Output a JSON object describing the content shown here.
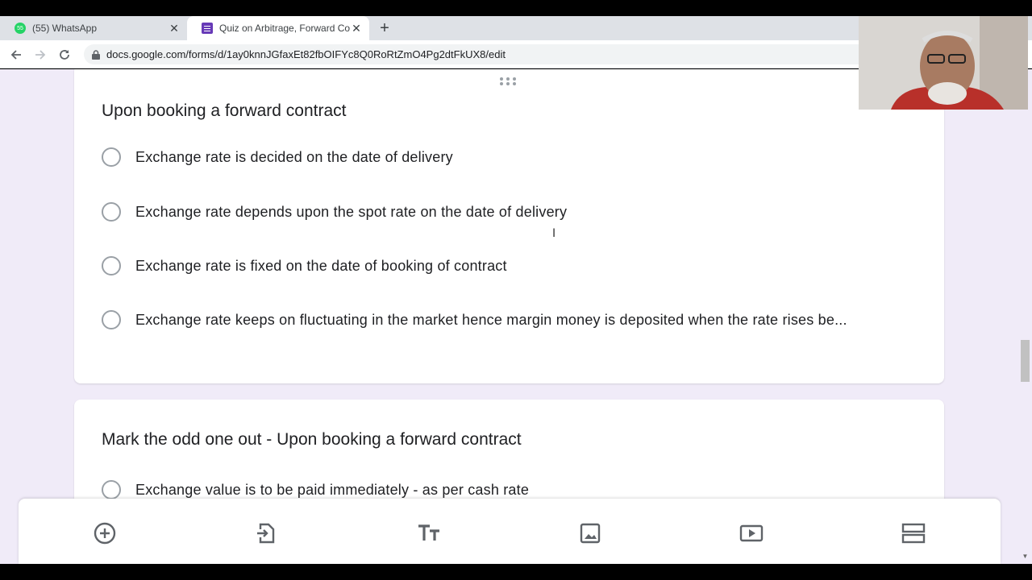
{
  "browser": {
    "tabs": [
      {
        "title": "(55) WhatsApp",
        "icon": "whatsapp-icon",
        "active": false
      },
      {
        "title": "Quiz on Arbitrage, Forward Cont",
        "icon": "google-forms-icon",
        "active": true
      }
    ],
    "url": "docs.google.com/forms/d/1ay0knnJGfaxEt82fbOIFYc8Q0RoRtZmO4Pg2dtFkUX8/edit",
    "whatsapp_badge": "55"
  },
  "questions": [
    {
      "title": "Upon booking a forward contract",
      "options": [
        "Exchange rate is decided on the date of delivery",
        "Exchange rate depends upon the spot rate on the date of delivery",
        "Exchange rate is fixed on the date of booking of contract",
        "Exchange rate keeps on fluctuating in the market hence margin money is deposited when the rate rises be..."
      ]
    },
    {
      "title": "Mark the odd one out -  Upon booking a forward contract",
      "options": [
        "Exchange value is to be paid immediately - as per cash rate"
      ]
    }
  ],
  "toolbar": {
    "icons": [
      "add-question-icon",
      "import-questions-icon",
      "add-title-icon",
      "add-image-icon",
      "add-video-icon",
      "add-section-icon"
    ]
  },
  "colors": {
    "page_bg": "#f0ebf8",
    "forms_purple": "#673ab7",
    "radio_border": "#9aa0a6"
  }
}
